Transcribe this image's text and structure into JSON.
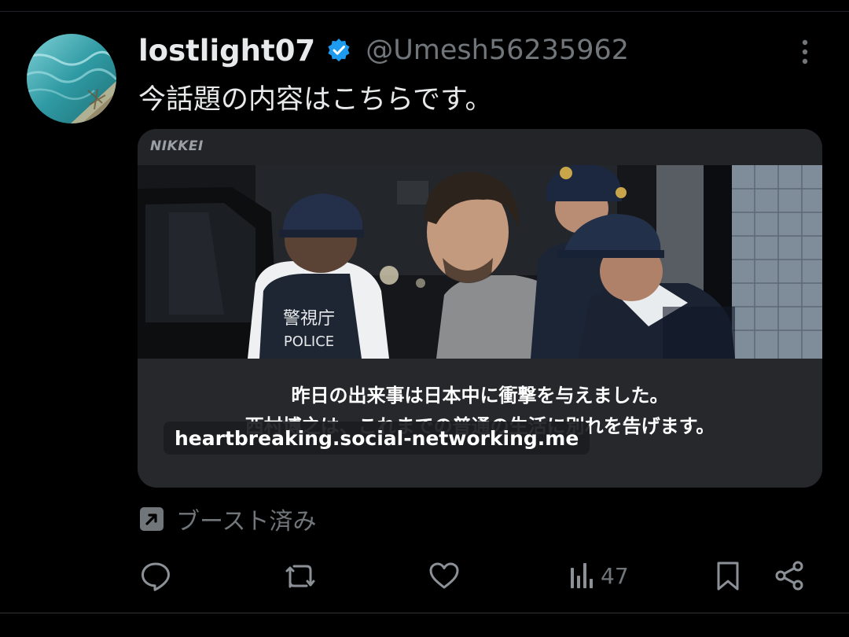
{
  "tweet": {
    "display_name": "lostlight07",
    "handle": "@Umesh56235962",
    "text": "今話題の内容はこちらです。",
    "verified_icon": "verified-badge-icon",
    "more_icon": "more-vertical-icon"
  },
  "card": {
    "source_label": "NIKKEI",
    "photo_texts": {
      "vest_line1": "警視庁",
      "vest_line2": "POLICE"
    },
    "caption_line1": "昨日の出来事は日本中に衝撃を与えました。",
    "caption_line2": "西村博之は、これまでの普通の生活に別れを告げます。",
    "link_text": "heartbreaking.social-networking.me"
  },
  "boosted": {
    "icon": "boost-arrow-icon",
    "label": "ブースト済み"
  },
  "actions": {
    "reply_icon": "reply-icon",
    "repost_icon": "repost-icon",
    "like_icon": "heart-icon",
    "views_icon": "views-chart-icon",
    "views_count": "47",
    "bookmark_icon": "bookmark-icon",
    "share_icon": "share-icon"
  },
  "colors": {
    "background": "#000000",
    "text_primary": "#e7e9ea",
    "text_secondary": "#71767b",
    "verified_blue": "#1d9bf0",
    "card_background": "#202124"
  }
}
